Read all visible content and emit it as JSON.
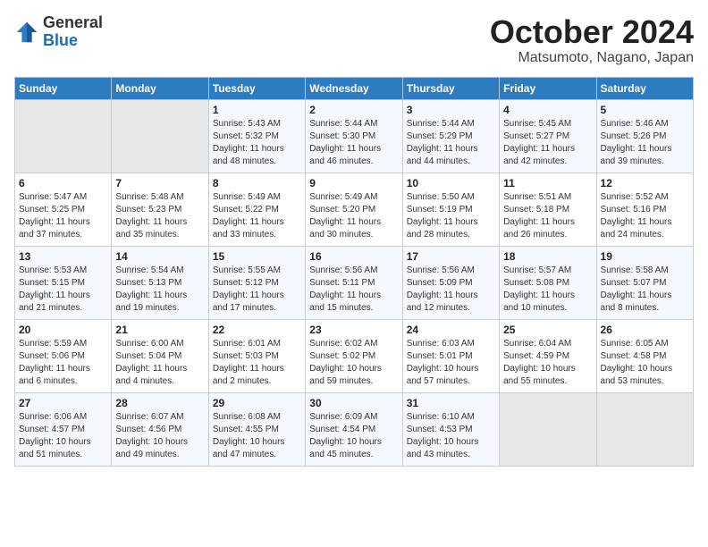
{
  "header": {
    "logo_general": "General",
    "logo_blue": "Blue",
    "month_title": "October 2024",
    "location": "Matsumoto, Nagano, Japan"
  },
  "columns": [
    "Sunday",
    "Monday",
    "Tuesday",
    "Wednesday",
    "Thursday",
    "Friday",
    "Saturday"
  ],
  "weeks": [
    [
      {
        "day": "",
        "info": ""
      },
      {
        "day": "",
        "info": ""
      },
      {
        "day": "1",
        "info": "Sunrise: 5:43 AM\nSunset: 5:32 PM\nDaylight: 11 hours\nand 48 minutes."
      },
      {
        "day": "2",
        "info": "Sunrise: 5:44 AM\nSunset: 5:30 PM\nDaylight: 11 hours\nand 46 minutes."
      },
      {
        "day": "3",
        "info": "Sunrise: 5:44 AM\nSunset: 5:29 PM\nDaylight: 11 hours\nand 44 minutes."
      },
      {
        "day": "4",
        "info": "Sunrise: 5:45 AM\nSunset: 5:27 PM\nDaylight: 11 hours\nand 42 minutes."
      },
      {
        "day": "5",
        "info": "Sunrise: 5:46 AM\nSunset: 5:26 PM\nDaylight: 11 hours\nand 39 minutes."
      }
    ],
    [
      {
        "day": "6",
        "info": "Sunrise: 5:47 AM\nSunset: 5:25 PM\nDaylight: 11 hours\nand 37 minutes."
      },
      {
        "day": "7",
        "info": "Sunrise: 5:48 AM\nSunset: 5:23 PM\nDaylight: 11 hours\nand 35 minutes."
      },
      {
        "day": "8",
        "info": "Sunrise: 5:49 AM\nSunset: 5:22 PM\nDaylight: 11 hours\nand 33 minutes."
      },
      {
        "day": "9",
        "info": "Sunrise: 5:49 AM\nSunset: 5:20 PM\nDaylight: 11 hours\nand 30 minutes."
      },
      {
        "day": "10",
        "info": "Sunrise: 5:50 AM\nSunset: 5:19 PM\nDaylight: 11 hours\nand 28 minutes."
      },
      {
        "day": "11",
        "info": "Sunrise: 5:51 AM\nSunset: 5:18 PM\nDaylight: 11 hours\nand 26 minutes."
      },
      {
        "day": "12",
        "info": "Sunrise: 5:52 AM\nSunset: 5:16 PM\nDaylight: 11 hours\nand 24 minutes."
      }
    ],
    [
      {
        "day": "13",
        "info": "Sunrise: 5:53 AM\nSunset: 5:15 PM\nDaylight: 11 hours\nand 21 minutes."
      },
      {
        "day": "14",
        "info": "Sunrise: 5:54 AM\nSunset: 5:13 PM\nDaylight: 11 hours\nand 19 minutes."
      },
      {
        "day": "15",
        "info": "Sunrise: 5:55 AM\nSunset: 5:12 PM\nDaylight: 11 hours\nand 17 minutes."
      },
      {
        "day": "16",
        "info": "Sunrise: 5:56 AM\nSunset: 5:11 PM\nDaylight: 11 hours\nand 15 minutes."
      },
      {
        "day": "17",
        "info": "Sunrise: 5:56 AM\nSunset: 5:09 PM\nDaylight: 11 hours\nand 12 minutes."
      },
      {
        "day": "18",
        "info": "Sunrise: 5:57 AM\nSunset: 5:08 PM\nDaylight: 11 hours\nand 10 minutes."
      },
      {
        "day": "19",
        "info": "Sunrise: 5:58 AM\nSunset: 5:07 PM\nDaylight: 11 hours\nand 8 minutes."
      }
    ],
    [
      {
        "day": "20",
        "info": "Sunrise: 5:59 AM\nSunset: 5:06 PM\nDaylight: 11 hours\nand 6 minutes."
      },
      {
        "day": "21",
        "info": "Sunrise: 6:00 AM\nSunset: 5:04 PM\nDaylight: 11 hours\nand 4 minutes."
      },
      {
        "day": "22",
        "info": "Sunrise: 6:01 AM\nSunset: 5:03 PM\nDaylight: 11 hours\nand 2 minutes."
      },
      {
        "day": "23",
        "info": "Sunrise: 6:02 AM\nSunset: 5:02 PM\nDaylight: 10 hours\nand 59 minutes."
      },
      {
        "day": "24",
        "info": "Sunrise: 6:03 AM\nSunset: 5:01 PM\nDaylight: 10 hours\nand 57 minutes."
      },
      {
        "day": "25",
        "info": "Sunrise: 6:04 AM\nSunset: 4:59 PM\nDaylight: 10 hours\nand 55 minutes."
      },
      {
        "day": "26",
        "info": "Sunrise: 6:05 AM\nSunset: 4:58 PM\nDaylight: 10 hours\nand 53 minutes."
      }
    ],
    [
      {
        "day": "27",
        "info": "Sunrise: 6:06 AM\nSunset: 4:57 PM\nDaylight: 10 hours\nand 51 minutes."
      },
      {
        "day": "28",
        "info": "Sunrise: 6:07 AM\nSunset: 4:56 PM\nDaylight: 10 hours\nand 49 minutes."
      },
      {
        "day": "29",
        "info": "Sunrise: 6:08 AM\nSunset: 4:55 PM\nDaylight: 10 hours\nand 47 minutes."
      },
      {
        "day": "30",
        "info": "Sunrise: 6:09 AM\nSunset: 4:54 PM\nDaylight: 10 hours\nand 45 minutes."
      },
      {
        "day": "31",
        "info": "Sunrise: 6:10 AM\nSunset: 4:53 PM\nDaylight: 10 hours\nand 43 minutes."
      },
      {
        "day": "",
        "info": ""
      },
      {
        "day": "",
        "info": ""
      }
    ]
  ]
}
